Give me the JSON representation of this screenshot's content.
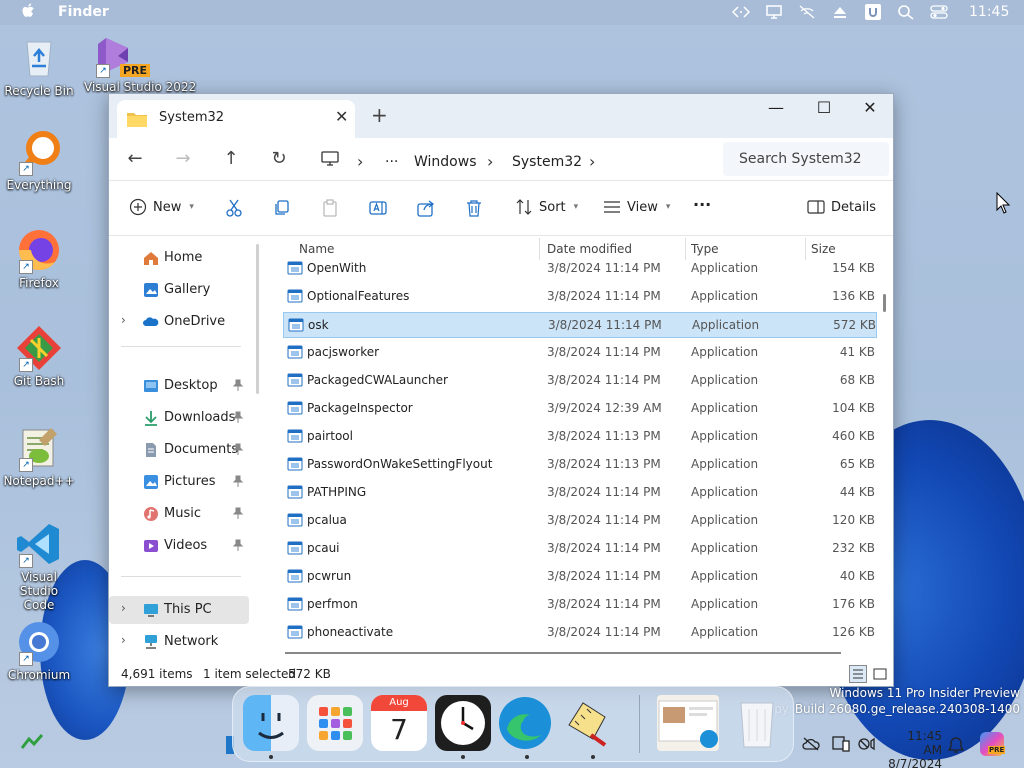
{
  "menubar": {
    "app_name": "Finder",
    "clock": "11:45",
    "icons": [
      "code-brackets-icon",
      "display-icon",
      "no-wifi-icon",
      "eject-icon",
      "user-u-icon",
      "search-icon",
      "control-center-icon"
    ]
  },
  "desktop": {
    "icons": [
      {
        "label": "Recycle Bin"
      },
      {
        "label": "Visual Studio 2022",
        "badge": "PRE"
      },
      {
        "label": "Everything"
      },
      {
        "label": "Firefox"
      },
      {
        "label": "Git Bash"
      },
      {
        "label": "Notepad++"
      },
      {
        "label": "Visual Studio Code"
      },
      {
        "label": "Chromium"
      }
    ],
    "watermark_line1": "Windows 11 Pro Insider Preview",
    "watermark_line2": "n copy. Build 26080.ge_release.240308-1400"
  },
  "explorer": {
    "tab_title": "System32",
    "new_tab": "+",
    "window_controls": {
      "minimize": "—",
      "maximize": "☐",
      "close": "✕"
    },
    "nav": {
      "back": "←",
      "forward": "→",
      "up": "↑",
      "refresh": "↻"
    },
    "breadcrumb": {
      "more": "···",
      "items": [
        "Windows",
        "System32"
      ],
      "sep": "›"
    },
    "search_placeholder": "Search System32",
    "commands": {
      "new": "New",
      "sort": "Sort",
      "view": "View",
      "more": "···",
      "details": "Details"
    },
    "sidebar": {
      "top": [
        {
          "label": "Home"
        },
        {
          "label": "Gallery"
        },
        {
          "label": "OneDrive",
          "expand": "›"
        }
      ],
      "quick": [
        {
          "label": "Desktop"
        },
        {
          "label": "Downloads"
        },
        {
          "label": "Documents"
        },
        {
          "label": "Pictures"
        },
        {
          "label": "Music"
        },
        {
          "label": "Videos"
        }
      ],
      "bottom": [
        {
          "label": "This PC",
          "expand": "›"
        },
        {
          "label": "Network",
          "expand": "›"
        }
      ]
    },
    "columns": {
      "name": "Name",
      "date": "Date modified",
      "type": "Type",
      "size": "Size"
    },
    "files": [
      {
        "name": "OpenWith",
        "date": "3/8/2024 11:14 PM",
        "type": "Application",
        "size": "154 KB"
      },
      {
        "name": "OptionalFeatures",
        "date": "3/8/2024 11:14 PM",
        "type": "Application",
        "size": "136 KB"
      },
      {
        "name": "osk",
        "date": "3/8/2024 11:14 PM",
        "type": "Application",
        "size": "572 KB"
      },
      {
        "name": "pacjsworker",
        "date": "3/8/2024 11:14 PM",
        "type": "Application",
        "size": "41 KB"
      },
      {
        "name": "PackagedCWALauncher",
        "date": "3/8/2024 11:14 PM",
        "type": "Application",
        "size": "68 KB"
      },
      {
        "name": "PackageInspector",
        "date": "3/9/2024 12:39 AM",
        "type": "Application",
        "size": "104 KB"
      },
      {
        "name": "pairtool",
        "date": "3/8/2024 11:13 PM",
        "type": "Application",
        "size": "460 KB"
      },
      {
        "name": "PasswordOnWakeSettingFlyout",
        "date": "3/8/2024 11:13 PM",
        "type": "Application",
        "size": "65 KB"
      },
      {
        "name": "PATHPING",
        "date": "3/8/2024 11:14 PM",
        "type": "Application",
        "size": "44 KB"
      },
      {
        "name": "pcalua",
        "date": "3/8/2024 11:14 PM",
        "type": "Application",
        "size": "120 KB"
      },
      {
        "name": "pcaui",
        "date": "3/8/2024 11:14 PM",
        "type": "Application",
        "size": "232 KB"
      },
      {
        "name": "pcwrun",
        "date": "3/8/2024 11:14 PM",
        "type": "Application",
        "size": "40 KB"
      },
      {
        "name": "perfmon",
        "date": "3/8/2024 11:14 PM",
        "type": "Application",
        "size": "176 KB"
      },
      {
        "name": "phoneactivate",
        "date": "3/8/2024 11:14 PM",
        "type": "Application",
        "size": "126 KB"
      }
    ],
    "selected_index": 2,
    "status": {
      "items": "4,691 items",
      "selected": "1 item selected",
      "size": "572 KB"
    }
  },
  "dock": {
    "calendar_month": "Aug",
    "calendar_day": "7"
  },
  "taskbar": {
    "time": "11:45 AM",
    "date": "8/7/2024",
    "copilot_badge": "PRE"
  }
}
